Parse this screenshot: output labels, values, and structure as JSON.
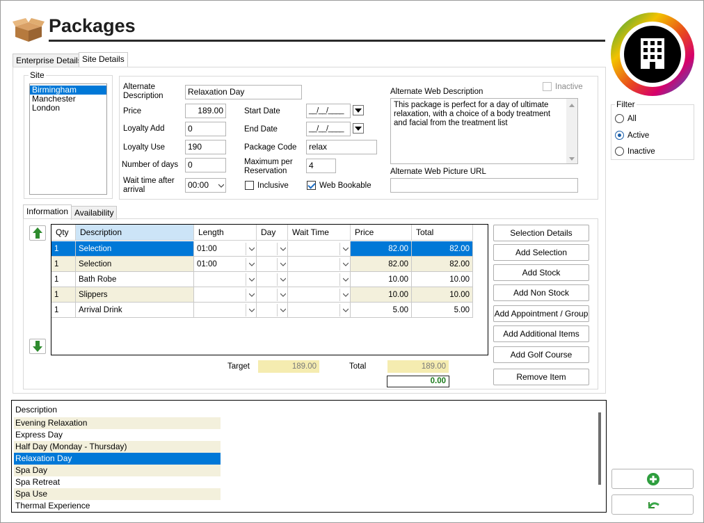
{
  "header": {
    "title": "Packages"
  },
  "tabs": {
    "enterprise": "Enterprise Details",
    "site": "Site Details"
  },
  "site": {
    "label": "Site",
    "items": [
      "Birmingham",
      "Manchester",
      "London"
    ],
    "selected": 0
  },
  "fields": {
    "alt_desc_label": "Alternate Description",
    "alt_desc_value": "Relaxation Day",
    "price_label": "Price",
    "price_value": "189.00",
    "loyalty_add_label": "Loyalty Add",
    "loyalty_add_value": "0",
    "loyalty_use_label": "Loyalty Use",
    "loyalty_use_value": "190",
    "num_days_label": "Number of days",
    "num_days_value": "0",
    "wait_label": "Wait time after arrival",
    "wait_value": "00:00",
    "start_date_label": "Start Date",
    "start_date_value": "__/__/____",
    "end_date_label": "End Date",
    "end_date_value": "__/__/____",
    "package_code_label": "Package Code",
    "package_code_value": "relax",
    "max_res_label": "Maximum per Reservation",
    "max_res_value": "4",
    "inclusive_label": "Inclusive",
    "web_bookable_label": "Web Bookable",
    "inactive_label": "Inactive",
    "alt_web_desc_label": "Alternate Web Description",
    "alt_web_desc_value": "This package is perfect for a day of ultimate relaxation, with a choice of a body treatment and facial from the treatment list",
    "alt_web_pic_label": "Alternate Web Picture URL"
  },
  "subtabs": {
    "information": "Information",
    "availability": "Availability"
  },
  "grid": {
    "headers": {
      "qty": "Qty",
      "description": "Description",
      "length": "Length",
      "day": "Day",
      "wait": "Wait Time",
      "price": "Price",
      "total": "Total"
    },
    "rows": [
      {
        "qty": "1",
        "description": "Selection",
        "length": "01:00",
        "price": "82.00",
        "total": "82.00"
      },
      {
        "qty": "1",
        "description": "Selection",
        "length": "01:00",
        "price": "82.00",
        "total": "82.00"
      },
      {
        "qty": "1",
        "description": "Bath Robe",
        "length": "",
        "price": "10.00",
        "total": "10.00"
      },
      {
        "qty": "1",
        "description": "Slippers",
        "length": "",
        "price": "10.00",
        "total": "10.00"
      },
      {
        "qty": "1",
        "description": "Arrival Drink",
        "length": "",
        "price": "5.00",
        "total": "5.00"
      }
    ],
    "selected_row": 0
  },
  "actions": {
    "selection_details": "Selection Details",
    "add_selection": "Add Selection",
    "add_stock": "Add Stock",
    "add_non_stock": "Add Non Stock",
    "add_appointment": "Add Appointment / Group",
    "add_additional": "Add Additional Items",
    "add_golf": "Add Golf Course",
    "remove_item": "Remove Item"
  },
  "summary": {
    "target_label": "Target",
    "target_value": "189.00",
    "total_label": "Total",
    "total_value": "189.00",
    "difference": "0.00"
  },
  "filter": {
    "label": "Filter",
    "options": [
      "All",
      "Active",
      "Inactive"
    ],
    "selected": 1
  },
  "packages_list": {
    "header": "Description",
    "items": [
      "Evening Relaxation",
      "Express Day",
      "Half Day (Monday - Thursday)",
      "Relaxation Day",
      "Spa Day",
      "Spa Retreat",
      "Spa Use",
      "Thermal Experience"
    ],
    "selected": 3
  },
  "colors": {
    "accent": "#0078d7",
    "summary_fill": "#f5ecb0",
    "row_alt": "#f3f0dc",
    "difference": "#1a7a1a"
  }
}
